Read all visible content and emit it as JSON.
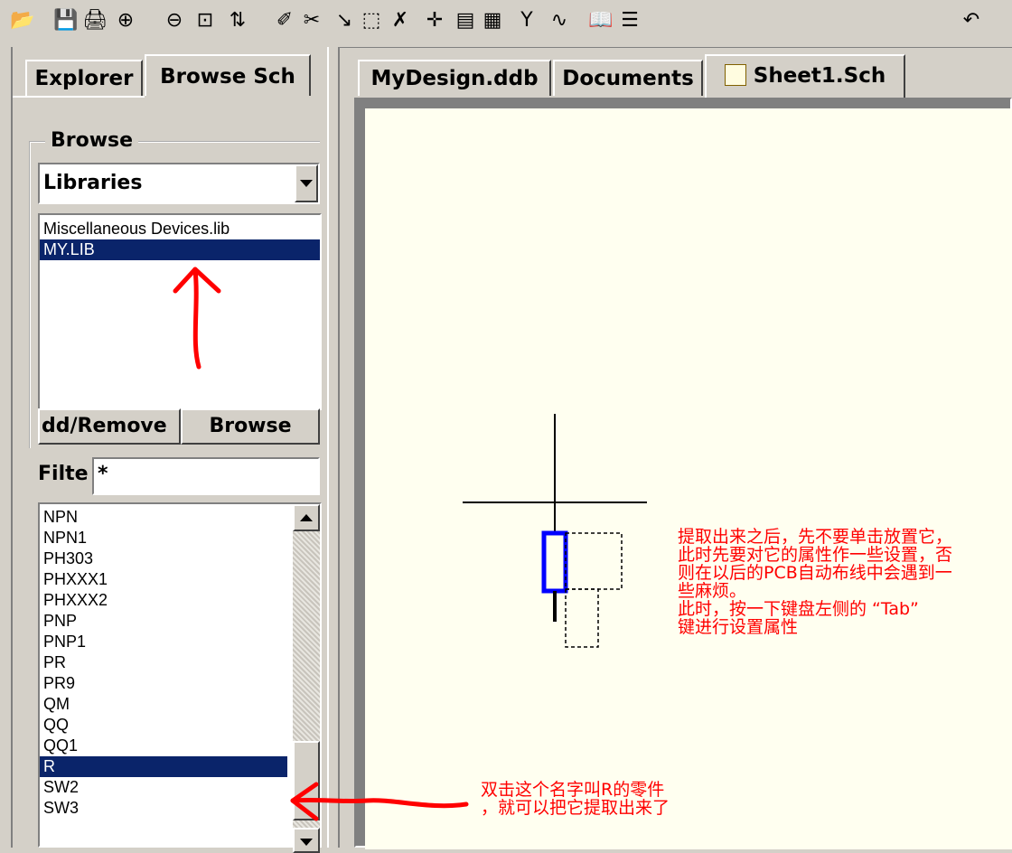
{
  "toolbar": {
    "icons": [
      {
        "name": "open-folder-icon",
        "glyph": "📂"
      },
      {
        "name": "save-icon",
        "glyph": "💾"
      },
      {
        "name": "print-icon",
        "glyph": "🖨"
      },
      {
        "name": "zoom-in-icon",
        "glyph": "⊕"
      },
      {
        "name": "zoom-out-icon",
        "glyph": "⊖"
      },
      {
        "name": "zoom-fit-icon",
        "glyph": "⊡"
      },
      {
        "name": "hierarchy-icon",
        "glyph": "⇅"
      },
      {
        "name": "magic-wand-icon",
        "glyph": "✐"
      },
      {
        "name": "wire-tool-icon",
        "glyph": "✂"
      },
      {
        "name": "line-tool-icon",
        "glyph": "↘"
      },
      {
        "name": "select-rect-icon",
        "glyph": "⬚"
      },
      {
        "name": "deselect-icon",
        "glyph": "✗"
      },
      {
        "name": "move-icon",
        "glyph": "✛"
      },
      {
        "name": "library-icon",
        "glyph": "▤"
      },
      {
        "name": "browse-library-icon",
        "glyph": "▦"
      },
      {
        "name": "probe-icon",
        "glyph": "Y"
      },
      {
        "name": "simulate-icon",
        "glyph": "∿"
      },
      {
        "name": "book-icon",
        "glyph": "📖"
      },
      {
        "name": "list-icon",
        "glyph": "☰"
      },
      {
        "name": "undo-icon",
        "glyph": "↶"
      }
    ]
  },
  "left_panel": {
    "tabs": {
      "explorer": "Explorer",
      "browse_sch": "Browse Sch"
    },
    "browse_group_label": "Browse",
    "browse_select_value": "Libraries",
    "libraries": [
      "Miscellaneous Devices.lib",
      "MY.LIB"
    ],
    "selected_library": "MY.LIB",
    "add_remove_label": "dd/Remove",
    "browse_button_label": "Browse",
    "filter_label": "Filte",
    "filter_value": "*",
    "components": [
      "NPN",
      "NPN1",
      "PH303",
      "PHXXX1",
      "PHXXX2",
      "PNP",
      "PNP1",
      "PR",
      "PR9",
      "QM",
      "QQ",
      "QQ1",
      "R",
      "SW2",
      "SW3"
    ],
    "selected_component": "R"
  },
  "doc_tabs": [
    "MyDesign.ddb",
    "Documents",
    "Sheet1.Sch"
  ],
  "active_doc_tab": "Sheet1.Sch",
  "annotations": {
    "canvas_note": [
      "提取出来之后，先不要单击放置它，",
      "此时先要对它的属性作一些设置，否",
      "则在以后的PCB自动布线中会遇到一",
      "些麻烦。",
      "此时，按一下键盘左侧的 “Tab”",
      "键进行设置属性"
    ],
    "list_note": [
      "双击这个名字叫R的零件",
      "，就可以把它提取出来了"
    ]
  },
  "colors": {
    "annotation": "#ff0000",
    "selection": "#0a246a",
    "canvas": "#fffff0",
    "component": "#0000ff"
  }
}
